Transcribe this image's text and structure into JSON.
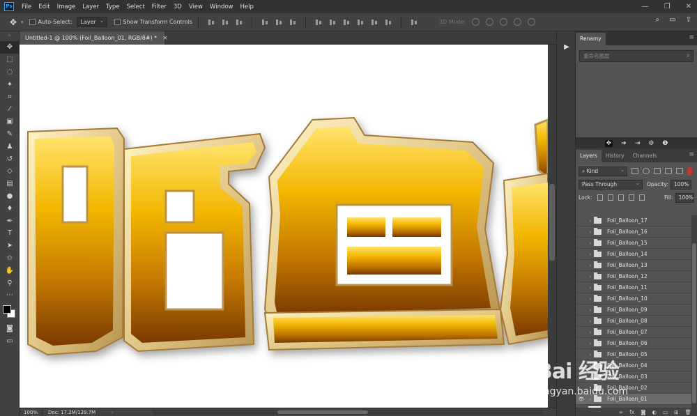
{
  "app": {
    "logo": "Ps",
    "menu": [
      "File",
      "Edit",
      "Image",
      "Layer",
      "Type",
      "Select",
      "Filter",
      "3D",
      "View",
      "Window",
      "Help"
    ]
  },
  "options_bar": {
    "auto_select_label": "Auto-Select:",
    "auto_select_value": "Layer",
    "transform_controls_label": "Show Transform Controls",
    "mode_3d_label": "3D Mode:"
  },
  "document": {
    "tab_title": "Untitled-1 @ 100% (Foil_Balloon_01, RGB/8#) *",
    "zoom": "100%",
    "doc_info": "Doc: 17.2M/139.7M",
    "artwork_text": "陌鱼"
  },
  "renamy": {
    "tab": "Renamy",
    "search_placeholder": "重命名图层"
  },
  "layers_panel": {
    "tabs": [
      "Layers",
      "History",
      "Channels"
    ],
    "active_tab": "Layers",
    "filter_kind": "Kind",
    "blend_mode": "Pass Through",
    "opacity_label": "Opacity:",
    "opacity_value": "100%",
    "lock_label": "Lock:",
    "fill_label": "Fill:",
    "fill_value": "100%",
    "layers": [
      {
        "name": "Foil_Balloon_17",
        "visible": false,
        "selected": false
      },
      {
        "name": "Foil_Balloon_16",
        "visible": false,
        "selected": false
      },
      {
        "name": "Foil_Balloon_15",
        "visible": false,
        "selected": false
      },
      {
        "name": "Foil_Balloon_14",
        "visible": false,
        "selected": false
      },
      {
        "name": "Foil_Balloon_13",
        "visible": false,
        "selected": false
      },
      {
        "name": "Foil_Balloon_12",
        "visible": false,
        "selected": false
      },
      {
        "name": "Foil_Balloon_11",
        "visible": false,
        "selected": false
      },
      {
        "name": "Foil_Balloon_10",
        "visible": false,
        "selected": false
      },
      {
        "name": "Foil_Balloon_09",
        "visible": false,
        "selected": false
      },
      {
        "name": "Foil_Balloon_08",
        "visible": false,
        "selected": false
      },
      {
        "name": "Foil_Balloon_07",
        "visible": false,
        "selected": false
      },
      {
        "name": "Foil_Balloon_06",
        "visible": false,
        "selected": false
      },
      {
        "name": "Foil_Balloon_05",
        "visible": false,
        "selected": false
      },
      {
        "name": "Foil_Balloon_04",
        "visible": false,
        "selected": false
      },
      {
        "name": "Foil_Balloon_03",
        "visible": false,
        "selected": false
      },
      {
        "name": "Foil_Balloon_02",
        "visible": false,
        "selected": false
      },
      {
        "name": "Foil_Balloon_01",
        "visible": true,
        "selected": true
      }
    ],
    "background_layer": "Background"
  },
  "watermark": {
    "logo": "Bai 经验",
    "url": "jingyan.baidu.com"
  },
  "colors": {
    "accent": "#31a8ff",
    "foil_gold": "#e8b000",
    "foil_dark": "#8a4a00",
    "foreground_swatch": "#000000",
    "background_swatch": "#ffffff"
  }
}
